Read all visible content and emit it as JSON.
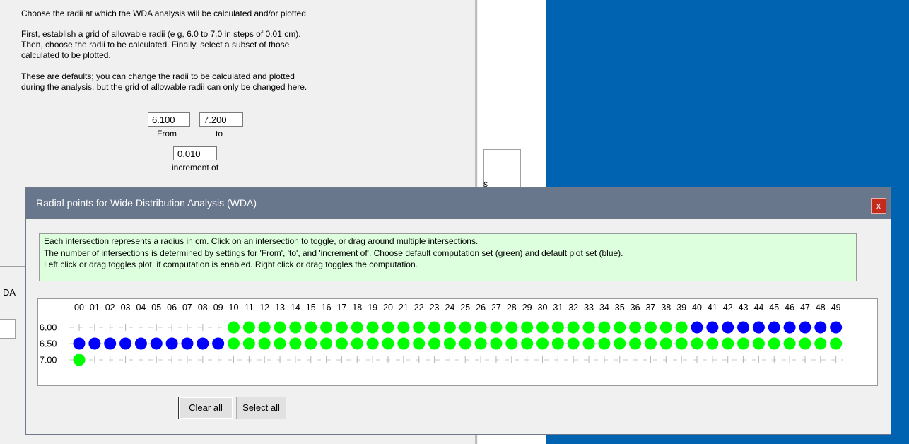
{
  "background_window": {
    "lines": [
      "Choose the radii at which the WDA analysis will be calculated and/or plotted.",
      "First, establish a grid of allowable radii (e g, 6.0 to 7.0 in steps of 0.01 cm).",
      "Then, choose the radii to be calculated. Finally, select a subset of those",
      "calculated to be plotted.",
      "These are defaults; you can change the radii to be calculated and plotted",
      "during the analysis, but the grid of allowable radii can only be changed here."
    ],
    "from_value": "6.100",
    "to_value": "7.200",
    "from_label": "From",
    "to_label": "to",
    "increment_value": "0.010",
    "increment_label": "increment of",
    "left_stub_text": "DA",
    "mid_box_char": "s"
  },
  "dialog": {
    "title": "Radial points for Wide Distribution Analysis (WDA)",
    "close_label": "x",
    "info_lines": [
      "Each intersection represents a radius in cm.  Click on an intersection to toggle, or drag around multiple intersections.",
      "The number of intersections is determined by settings for 'From', 'to', and 'increment of'. Choose default computation set (green) and default plot set (blue).",
      "Left click or drag toggles plot, if computation is enabled. Right click or drag toggles the computation."
    ],
    "clear_all_label": "Clear all",
    "select_all_label": "Select all",
    "colors": {
      "green": "#00ff00",
      "blue": "#0000ff"
    }
  },
  "grid": {
    "columns": [
      "00",
      "01",
      "02",
      "03",
      "04",
      "05",
      "06",
      "07",
      "08",
      "09",
      "10",
      "11",
      "12",
      "13",
      "14",
      "15",
      "16",
      "17",
      "18",
      "19",
      "20",
      "21",
      "22",
      "23",
      "24",
      "25",
      "26",
      "27",
      "28",
      "29",
      "30",
      "31",
      "32",
      "33",
      "34",
      "35",
      "36",
      "37",
      "38",
      "39",
      "40",
      "41",
      "42",
      "43",
      "44",
      "45",
      "46",
      "47",
      "48",
      "49"
    ],
    "rows": [
      "6.00",
      "6.50",
      "7.00"
    ],
    "states": [
      "nnnnnnnnnnggggggggggggggggggggggggggggggbbbbbbbbbb",
      "bbbbbbbbbbgggggggggggggggggggggggggggggggggggggggg",
      "gnnnnnnnnnnnnnnnnnnnnnnnnnnnnnnnnnnnnnnnnnnnnnnnnn"
    ]
  }
}
